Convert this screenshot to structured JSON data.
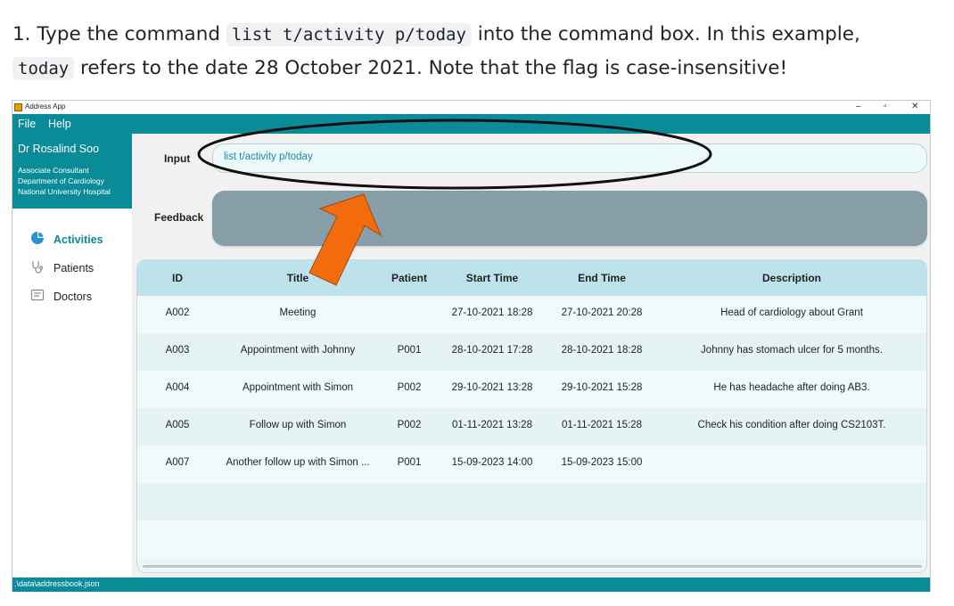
{
  "instruction": {
    "prefix": "1. Type the command ",
    "command_code": "list t/activity p/today",
    "middle": " into the command box. In this example,",
    "today_code": "today",
    "suffix": " refers to the date 28 October 2021. Note that the flag is case-insensitive!"
  },
  "window": {
    "title": "Address App",
    "minimize_glyph": "–",
    "maximize_glyph": "▫",
    "close_glyph": "✕"
  },
  "menu": {
    "file": "File",
    "help": "Help"
  },
  "profile": {
    "name": "Dr Rosalind Soo",
    "role": "Associate Consultant",
    "department": "Department of Cardiology",
    "hospital": "National University Hospital"
  },
  "sidebar": {
    "items": [
      {
        "label": "Activities",
        "icon": "pie-chart-icon",
        "active": true
      },
      {
        "label": "Patients",
        "icon": "stethoscope-icon",
        "active": false
      },
      {
        "label": "Doctors",
        "icon": "id-card-icon",
        "active": false
      }
    ]
  },
  "command": {
    "label": "Input",
    "value": "list t/activity p/today"
  },
  "feedback": {
    "label": "Feedback",
    "text": ""
  },
  "table": {
    "headers": [
      "ID",
      "Title",
      "Patient",
      "Start Time",
      "End Time",
      "Description"
    ],
    "rows": [
      [
        "A002",
        "Meeting",
        "",
        "27-10-2021 18:28",
        "27-10-2021 20:28",
        "Head of cardiology about Grant"
      ],
      [
        "A003",
        "Appointment with Johnny",
        "P001",
        "28-10-2021 17:28",
        "28-10-2021 18:28",
        "Johnny has stomach ulcer for 5 months."
      ],
      [
        "A004",
        "Appointment with Simon",
        "P002",
        "29-10-2021 13:28",
        "29-10-2021 15:28",
        "He has headache after doing AB3."
      ],
      [
        "A005",
        "Follow up with Simon",
        "P002",
        "01-11-2021 13:28",
        "01-11-2021 15:28",
        "Check his condition after doing CS2103T."
      ],
      [
        "A007",
        "Another follow up with Simon ...",
        "P001",
        "15-09-2023 14:00",
        "15-09-2023 15:00",
        ""
      ]
    ]
  },
  "status": {
    "path": ".\\data\\addressbook.json"
  },
  "colors": {
    "accent": "#098b98",
    "arrow": "#f26c0d",
    "header": "#bde2ec",
    "feedback": "#879ea8"
  }
}
